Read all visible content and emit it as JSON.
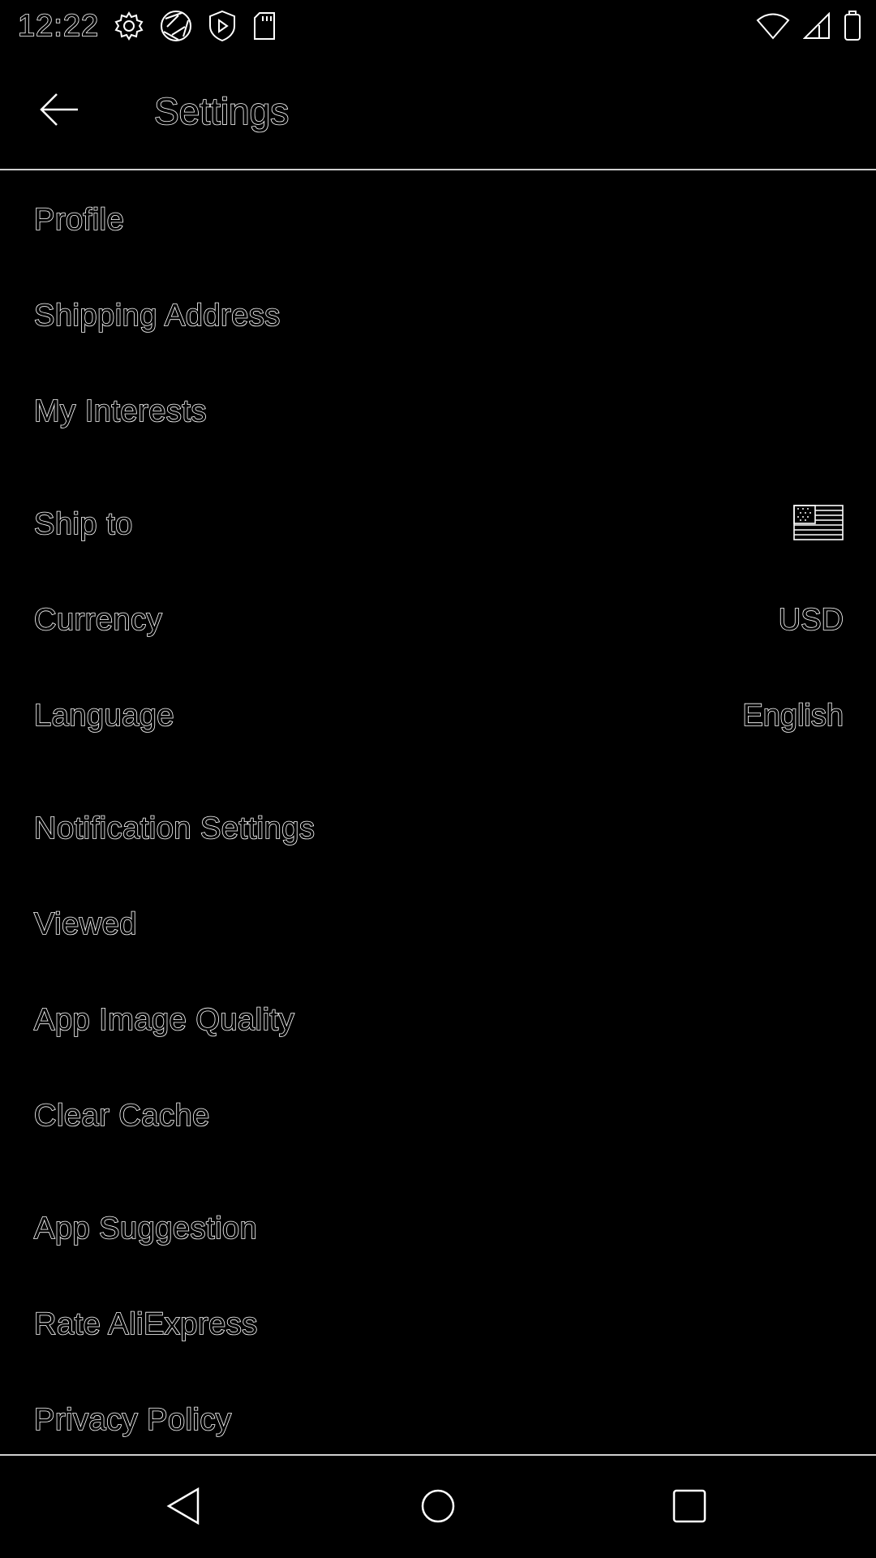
{
  "status_bar": {
    "time": "12:22",
    "left_icons": [
      "gear-icon",
      "aperture-icon",
      "play-shield-icon",
      "sd-card-icon"
    ],
    "right_icons": [
      "wifi-icon",
      "cell-signal-icon",
      "battery-icon"
    ]
  },
  "app_bar": {
    "title": "Settings",
    "back_icon": "arrow-left-icon"
  },
  "settings": {
    "group1": [
      {
        "label": "Profile"
      },
      {
        "label": "Shipping Address"
      },
      {
        "label": "My Interests"
      }
    ],
    "group2": [
      {
        "label": "Ship to",
        "value_icon": "us-flag-icon"
      },
      {
        "label": "Currency",
        "value": "USD"
      },
      {
        "label": "Language",
        "value": "English"
      }
    ],
    "group3": [
      {
        "label": "Notification Settings"
      },
      {
        "label": "Viewed"
      },
      {
        "label": "App Image Quality"
      },
      {
        "label": "Clear Cache"
      }
    ],
    "group4": [
      {
        "label": "App Suggestion"
      },
      {
        "label": "Rate AliExpress"
      },
      {
        "label": "Privacy Policy"
      }
    ]
  },
  "nav_bar": {
    "icons": [
      "nav-back-icon",
      "nav-home-icon",
      "nav-recents-icon"
    ]
  },
  "colors": {
    "background": "#000000",
    "outline": "#ffffff",
    "divider": "#cfcfcf"
  }
}
